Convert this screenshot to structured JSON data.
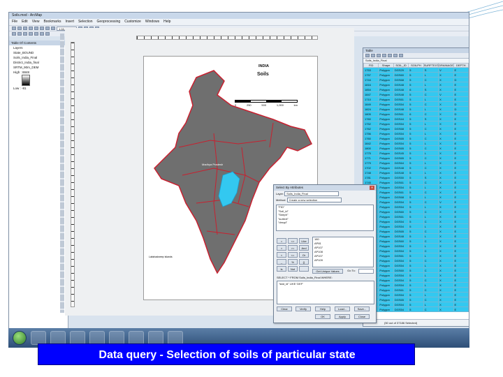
{
  "app": {
    "title": "Soils.mxd - ArcMap",
    "menu": [
      "File",
      "Edit",
      "View",
      "Bookmarks",
      "Insert",
      "Selection",
      "Geoprocessing",
      "Customize",
      "Windows",
      "Help"
    ],
    "scale_value": "1:16,000,000",
    "accent_color": "#33c8f0"
  },
  "toc": {
    "title": "Table Of Contents",
    "layers_label": "Layers",
    "items": [
      "State_BOUND",
      "Soils_India_Final",
      "District_India_final",
      "SRTM_90m_DEM"
    ],
    "legend_high": "High : 8848",
    "legend_low": "Low : -81"
  },
  "map": {
    "title": "INDIA",
    "subtitle": "Soils",
    "scale_labels": [
      "0",
      "250",
      "500",
      "1,000"
    ],
    "scale_unit": "km",
    "region_label": "Madhya Pradesh",
    "islands_label": "Lakshadweep Islands",
    "highlight_color": "#33c8f0"
  },
  "attribute_table": {
    "title": "Table",
    "layer_name": "Soils_India_Final",
    "columns": [
      "FID",
      "Shape",
      "SOIL_ID",
      "SOILPH",
      "SURFTEXT",
      "DRAINAGE",
      "DEPTH"
    ],
    "rows": [
      [
        "1753",
        "Polygon",
        "DGS29",
        "5",
        "S",
        "V",
        "E"
      ],
      [
        "1757",
        "Polygon",
        "DGS60",
        "5",
        "L",
        "X",
        "E"
      ],
      [
        "1744",
        "Polygon",
        "DGS68",
        "5",
        "C",
        "X",
        "D"
      ],
      [
        "1816",
        "Polygon",
        "DGS48",
        "5",
        "L",
        "X",
        "E"
      ],
      [
        "1854",
        "Polygon",
        "DGS48",
        "6",
        "S",
        "X",
        "E"
      ],
      [
        "1847",
        "Polygon",
        "DGS48",
        "5",
        "C",
        "V",
        "E"
      ],
      [
        "1710",
        "Polygon",
        "DGS61",
        "5",
        "L",
        "X",
        "E"
      ],
      [
        "1849",
        "Polygon",
        "DGS54",
        "5",
        "C",
        "X",
        "D"
      ],
      [
        "1824",
        "Polygon",
        "DGS48",
        "5",
        "L",
        "X",
        "D"
      ],
      [
        "1805",
        "Polygon",
        "DGS61",
        "6",
        "C",
        "X",
        "D"
      ],
      [
        "1760",
        "Polygon",
        "DGS44",
        "5",
        "S",
        "X",
        "E"
      ],
      [
        "1752",
        "Polygon",
        "DGS54",
        "5",
        "L",
        "X",
        "E"
      ],
      [
        "1762",
        "Polygon",
        "DGS68",
        "5",
        "C",
        "X",
        "E"
      ],
      [
        "1756",
        "Polygon",
        "DGS54",
        "5",
        "L",
        "X",
        "E"
      ],
      [
        "1760",
        "Polygon",
        "DGS65",
        "5",
        "C",
        "X",
        "E"
      ],
      [
        "1842",
        "Polygon",
        "DGS54",
        "5",
        "L",
        "X",
        "E"
      ],
      [
        "1800",
        "Polygon",
        "DGS65",
        "5",
        "C",
        "X",
        "E"
      ],
      [
        "1775",
        "Polygon",
        "DGS45",
        "5",
        "L",
        "X",
        "E"
      ],
      [
        "1771",
        "Polygon",
        "DGS65",
        "5",
        "C",
        "X",
        "E"
      ],
      [
        "1779",
        "Polygon",
        "DGS64",
        "5",
        "L",
        "X",
        "E"
      ],
      [
        "1702",
        "Polygon",
        "DGS48",
        "5",
        "C",
        "X",
        "E"
      ],
      [
        "1748",
        "Polygon",
        "DGS48",
        "5",
        "L",
        "X",
        "E"
      ],
      [
        "1781",
        "Polygon",
        "DGS50",
        "5",
        "S",
        "X",
        "E"
      ],
      [
        "1745",
        "Polygon",
        "DGS61",
        "5",
        "C",
        "X",
        "E"
      ],
      [
        "1708",
        "Polygon",
        "DGS54",
        "5",
        "L",
        "X",
        "E"
      ],
      [
        "1726",
        "Polygon",
        "DGS61",
        "5",
        "C",
        "X",
        "E"
      ],
      [
        "1776",
        "Polygon",
        "DGS68",
        "5",
        "L",
        "X",
        "E"
      ],
      [
        "1738",
        "Polygon",
        "DGS54",
        "5",
        "C",
        "V",
        "E"
      ],
      [
        "1730",
        "Polygon",
        "DGS54",
        "5",
        "L",
        "X",
        "E"
      ],
      [
        "1792",
        "Polygon",
        "DGS60",
        "5",
        "C",
        "X",
        "E"
      ],
      [
        "1788",
        "Polygon",
        "DGS61",
        "5",
        "L",
        "X",
        "E"
      ],
      [
        "1767",
        "Polygon",
        "DGS54",
        "5",
        "C",
        "X",
        "E"
      ],
      [
        "1726",
        "Polygon",
        "DGS54",
        "5",
        "L",
        "X",
        "E"
      ],
      [
        "1750",
        "Polygon",
        "DGS65",
        "5",
        "C",
        "X",
        "E"
      ],
      [
        "1798",
        "Polygon",
        "DGS48",
        "5",
        "L",
        "X",
        "E"
      ],
      [
        "1756",
        "Polygon",
        "DGS60",
        "5",
        "C",
        "X",
        "E"
      ],
      [
        "1700",
        "Polygon",
        "DGS54",
        "5",
        "L",
        "X",
        "E"
      ],
      [
        "1746",
        "Polygon",
        "DGS54",
        "5",
        "C",
        "X",
        "E"
      ],
      [
        "1733",
        "Polygon",
        "DGS61",
        "5",
        "L",
        "X",
        "E"
      ],
      [
        "1751",
        "Polygon",
        "DGS54",
        "5",
        "C",
        "X",
        "E"
      ],
      [
        "1799",
        "Polygon",
        "DGS54",
        "5",
        "L",
        "X",
        "E"
      ],
      [
        "1782",
        "Polygon",
        "DGS60",
        "5",
        "C",
        "X",
        "E"
      ],
      [
        "1703",
        "Polygon",
        "DGS54",
        "5",
        "L",
        "X",
        "E"
      ],
      [
        "1761",
        "Polygon",
        "DGS54",
        "5",
        "C",
        "X",
        "E"
      ],
      [
        "1749",
        "Polygon",
        "DGS54",
        "5",
        "L",
        "X",
        "E"
      ],
      [
        "1778",
        "Polygon",
        "DGS61",
        "5",
        "C",
        "X",
        "E"
      ],
      [
        "1733",
        "Polygon",
        "DGS54",
        "5",
        "L",
        "X",
        "E"
      ],
      [
        "1782",
        "Polygon",
        "DGS65",
        "5",
        "C",
        "X",
        "E"
      ],
      [
        "1738",
        "Polygon",
        "DGS54",
        "5",
        "L",
        "X",
        "E"
      ],
      [
        "1764",
        "Polygon",
        "DGS54",
        "5",
        "C",
        "X",
        "E"
      ]
    ],
    "footer": "(50 out of 37186 Selected)"
  },
  "dialog": {
    "title": "Select By Attributes",
    "layer_label": "Layer:",
    "layer_value": "Soils_India_Final",
    "method_label": "Method:",
    "method_value": "Create a new selection",
    "fields": [
      "\"FID\"",
      "\"Soil_id\"",
      "\"Sdeph\"",
      "\"surtext\"",
      "\"drnqd\""
    ],
    "operators": [
      "=",
      "<>",
      "Like",
      ">",
      ">=",
      "And",
      "<",
      "<=",
      "Or",
      "_",
      "%",
      "()",
      "Is",
      "Not",
      ""
    ],
    "values": [
      "180",
      "AP81",
      "AP107",
      "AP108",
      "AP107",
      "AP109"
    ],
    "get_unique": "Get Unique Values",
    "go_to": "Go To:",
    "sql_prefix": "SELECT * FROM Soils_India_Final WHERE:",
    "sql_text": "\"stat_id\" LIKE 'DEF'",
    "buttons": [
      "Clear",
      "Verify",
      "Help",
      "Load...",
      "Save..."
    ],
    "bottom_buttons": [
      "OK",
      "Apply",
      "Close"
    ]
  },
  "caption": {
    "text": "Data query - Selection of soils of particular state"
  }
}
